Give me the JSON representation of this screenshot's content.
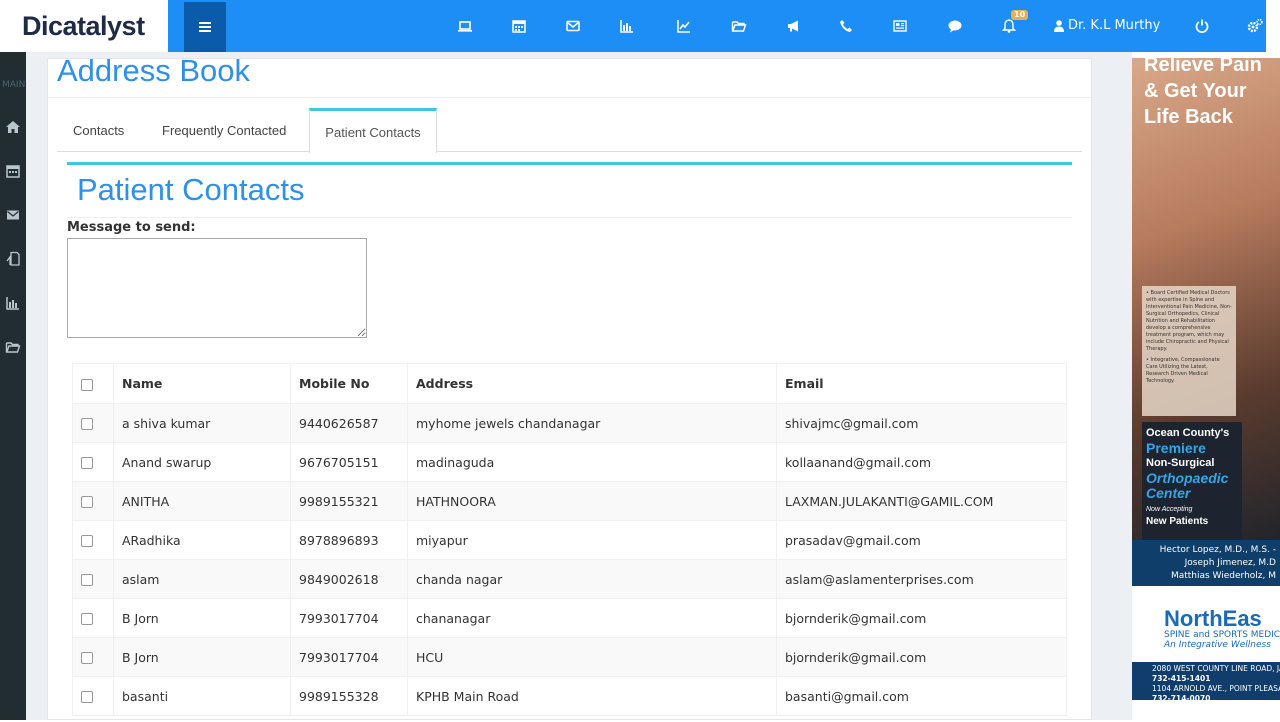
{
  "app": {
    "logo_text": "Dicatalyst",
    "user_name": "Dr. K.L Murthy",
    "notification_count": "10"
  },
  "sidebar": {
    "section_label": "MAIN"
  },
  "page": {
    "title": "Address Book"
  },
  "tabs": [
    {
      "label": "Contacts"
    },
    {
      "label": "Frequently Contacted"
    },
    {
      "label": "Patient Contacts"
    }
  ],
  "box": {
    "title": "Patient Contacts",
    "message_label": "Message to send:",
    "message_value": ""
  },
  "table": {
    "headers": [
      "Name",
      "Mobile No",
      "Address",
      "Email"
    ],
    "rows": [
      {
        "name": "a shiva kumar",
        "mobile": "9440626587",
        "address": "myhome jewels chandanagar",
        "email": "shivajmc@gmail.com"
      },
      {
        "name": "Anand swarup",
        "mobile": "9676705151",
        "address": "madinaguda",
        "email": "kollaanand@gmail.com"
      },
      {
        "name": "ANITHA",
        "mobile": "9989155321",
        "address": "HATHNOORA",
        "email": "LAXMAN.JULAKANTI@GAMIL.COM"
      },
      {
        "name": "ARadhika",
        "mobile": "8978896893",
        "address": "miyapur",
        "email": "prasadav@gmail.com"
      },
      {
        "name": "aslam",
        "mobile": "9849002618",
        "address": "chanda nagar",
        "email": "aslam@aslamenterprises.com"
      },
      {
        "name": "B Jorn",
        "mobile": "7993017704",
        "address": "chananagar",
        "email": "bjornderik@gmail.com"
      },
      {
        "name": "B Jorn",
        "mobile": "7993017704",
        "address": "HCU",
        "email": "bjornderik@gmail.com"
      },
      {
        "name": "basanti",
        "mobile": "9989155328",
        "address": "KPHB Main Road",
        "email": "basanti@gmail.com"
      }
    ]
  },
  "ad": {
    "headline_1": "Relieve Pain",
    "headline_2": "& Get Your",
    "headline_3": "Life Back",
    "bullet_1": "• Board Certified Medical Doctors with expertise in Spine and Interventional Pain Medicine, Non-Surgical Orthopedics, Clinical Nutrition and Rehabilitation develop a comprehensive treatment program, which may include Chiropractic and Physical Therapy.",
    "bullet_2": "• Integrative, Compassionate Care Utilizing the Latest, Research Driven Medical Technology.",
    "dark_1": "Ocean County's",
    "dark_2": "Premiere",
    "dark_3": "Non-Surgical",
    "dark_4": "Orthopaedic",
    "dark_5": "Center",
    "dark_6": "Now Accepting",
    "dark_7": "New Patients",
    "doctor_1": "Hector Lopez, M.D., M.S. -",
    "doctor_2": "Joseph Jimenez, M.D",
    "doctor_3": "Matthias Wiederholz, M",
    "brand": "NorthEas",
    "brand_sub": "SPINE and SPORTS MEDICIN",
    "brand_tag": "An Integrative Wellness",
    "addr_1": "2080 WEST COUNTY LINE ROAD, JA",
    "phone_1": "732-415-1401",
    "addr_2": "1104 ARNOLD AVE., POINT PLEASAN",
    "phone_2": "732-714-0070"
  }
}
